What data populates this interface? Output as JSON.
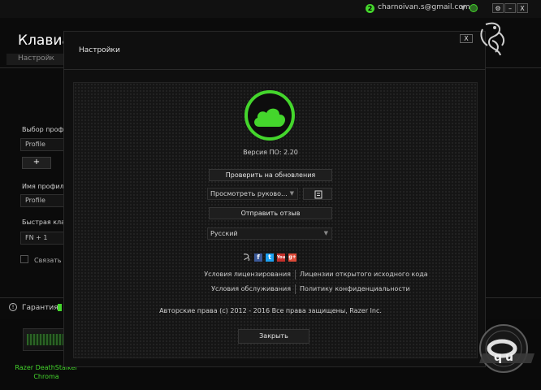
{
  "topbar": {
    "account_badge": "2",
    "account_email": "charnoivan.s@gmail.com",
    "account_arrow": "▼",
    "buttons": {
      "settings": "⚙",
      "minimize": "–",
      "close": "X"
    }
  },
  "app": {
    "title": "Клавиа",
    "tab_label": "Настройк",
    "profile_select_label": "Выбор профи",
    "profile_select_value": "Profile",
    "add_button": "+",
    "profile_name_label": "Имя профиля",
    "profile_name_value": "Profile",
    "quick_key_label": "Быстрая клав",
    "quick_key_value": "FN + 1",
    "link_label": "Связать с",
    "warranty_icon": "!",
    "warranty_label": "Гарантия",
    "device_name": "Razer DeathStalker Chroma"
  },
  "dialog": {
    "title": "Настройки",
    "close_label": "X",
    "version_text": "Версия ПО: 2.20",
    "check_updates_label": "Проверить на обновления",
    "guide_dropdown_value": "Просмотреть руково...",
    "send_feedback_label": "Отправить отзыв",
    "language_value": "Русский",
    "social_icons": [
      "razer-icon",
      "facebook-icon",
      "twitter-icon",
      "youtube-icon",
      "googleplus-icon"
    ],
    "social_glyphs": {
      "facebook": "f",
      "twitter": "t",
      "youtube": "You",
      "googleplus": "g+"
    },
    "links": {
      "license_terms": "Условия лицензирования",
      "open_source_licenses": "Лицензии открытого исходного кода",
      "terms_of_service": "Условия обслуживания",
      "privacy_policy": "Политику конфиденциальности"
    },
    "copyright": "Авторские права (c) 2012 - 2016 Все права защищены, Razer Inc.",
    "close_button_label": "Закрыть"
  },
  "colors": {
    "accent": "#44d62c",
    "background": "#0b0b0b",
    "panel": "#151515"
  }
}
